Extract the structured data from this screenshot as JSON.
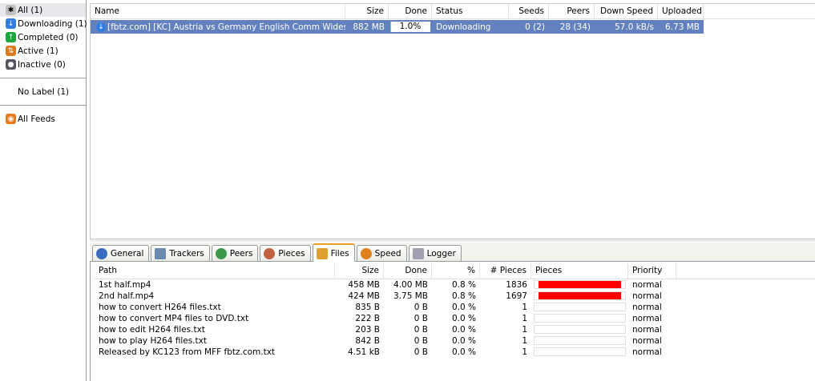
{
  "sidebar": {
    "items": [
      {
        "label": "All (1)",
        "icon": "asterisk-icon",
        "color": "#c0c0c0"
      },
      {
        "label": "Downloading (1)",
        "icon": "download-icon",
        "color": "#2f7ee0"
      },
      {
        "label": "Completed (0)",
        "icon": "upload-icon",
        "color": "#1ca83a"
      },
      {
        "label": "Active (1)",
        "icon": "active-arrows-icon",
        "color": "#d87a20"
      },
      {
        "label": "Inactive (0)",
        "icon": "inactive-icon",
        "color": "#555560"
      }
    ],
    "labels": [
      {
        "label": "No Label (1)"
      }
    ],
    "feeds": [
      {
        "label": "All Feeds",
        "icon": "rss-icon",
        "color": "#e87a1e"
      }
    ]
  },
  "torrents": {
    "columns": [
      "Name",
      "Size",
      "Done",
      "Status",
      "Seeds",
      "Peers",
      "Down Speed",
      "Uploaded"
    ],
    "rows": [
      {
        "name": "[fbtz.com] [KC] Austria vs Germany English Comm Widescr…",
        "size": "882 MB",
        "done": "1.0%",
        "done_fraction": 0.01,
        "status": "Downloading",
        "seeds": "0 (2)",
        "peers": "28 (34)",
        "down_speed": "57.0 kB/s",
        "uploaded": "6.73 MB"
      }
    ]
  },
  "tabs": [
    {
      "label": "General",
      "icon": "info-icon"
    },
    {
      "label": "Trackers",
      "icon": "network-icon"
    },
    {
      "label": "Peers",
      "icon": "peers-icon"
    },
    {
      "label": "Pieces",
      "icon": "pieces-icon"
    },
    {
      "label": "Files",
      "icon": "files-icon",
      "active": true
    },
    {
      "label": "Speed",
      "icon": "speed-icon"
    },
    {
      "label": "Logger",
      "icon": "logger-icon"
    }
  ],
  "files": {
    "columns": [
      "Path",
      "Size",
      "Done",
      "%",
      "# Pieces",
      "Pieces",
      "Priority"
    ],
    "rows": [
      {
        "path": "1st half.mp4",
        "size": "458 MB",
        "done": "4.00 MB",
        "pct": "0.8 %",
        "pieces": "1836",
        "priority": "normal",
        "bar": 1
      },
      {
        "path": "2nd half.mp4",
        "size": "424 MB",
        "done": "3.75 MB",
        "pct": "0.8 %",
        "pieces": "1697",
        "priority": "normal",
        "bar": 1
      },
      {
        "path": "how to convert H264 files.txt",
        "size": "835 B",
        "done": "0 B",
        "pct": "0.0 %",
        "pieces": "1",
        "priority": "normal",
        "bar": 0
      },
      {
        "path": "how to convert MP4 files to DVD.txt",
        "size": "222 B",
        "done": "0 B",
        "pct": "0.0 %",
        "pieces": "1",
        "priority": "normal",
        "bar": 0
      },
      {
        "path": "how to edit H264 files.txt",
        "size": "203 B",
        "done": "0 B",
        "pct": "0.0 %",
        "pieces": "1",
        "priority": "normal",
        "bar": 0
      },
      {
        "path": "how to play H264 files.txt",
        "size": "842 B",
        "done": "0 B",
        "pct": "0.0 %",
        "pieces": "1",
        "priority": "normal",
        "bar": 0
      },
      {
        "path": "Released by KC123 from MFF fbtz.com.txt",
        "size": "4.51 kB",
        "done": "0 B",
        "pct": "0.0 %",
        "pieces": "1",
        "priority": "normal",
        "bar": 0
      }
    ]
  },
  "colors": {
    "selection": "#6381bf",
    "pieces_bar": "#ff0000",
    "active_tab": "#f0a020"
  }
}
